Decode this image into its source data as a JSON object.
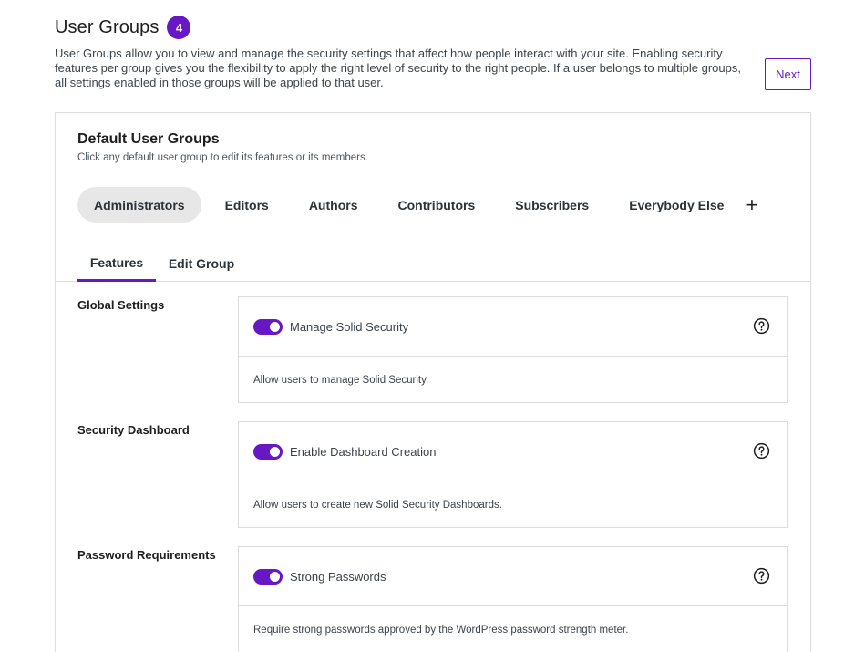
{
  "header": {
    "title": "User Groups",
    "count": "4",
    "description": "User Groups allow you to view and manage the security settings that affect how people interact with your site. Enabling security features per group gives you the flexibility to apply the right level of security to the right people. If a user belongs to multiple groups, all settings enabled in those groups will be applied to that user.",
    "next_label": "Next"
  },
  "card": {
    "title": "Default User Groups",
    "subtitle": "Click any default user group to edit its features or its members.",
    "groups": [
      "Administrators",
      "Editors",
      "Authors",
      "Contributors",
      "Subscribers",
      "Everybody Else"
    ],
    "selected_group": "Administrators",
    "add_symbol": "+",
    "tabs": [
      "Features",
      "Edit Group"
    ],
    "selected_tab": "Features"
  },
  "sections": [
    {
      "label": "Global Settings",
      "feature": "Manage Solid Security",
      "enabled": true,
      "description": "Allow users to manage Solid Security."
    },
    {
      "label": "Security Dashboard",
      "feature": "Enable Dashboard Creation",
      "enabled": true,
      "description": "Allow users to create new Solid Security Dashboards."
    },
    {
      "label": "Password Requirements",
      "feature": "Strong Passwords",
      "enabled": true,
      "description": "Require strong passwords approved by the WordPress password strength meter."
    }
  ],
  "colors": {
    "accent": "#6817c5",
    "border": "#dcdcde",
    "selected_tab_bg": "#e7e7e8"
  },
  "icons": {
    "help": "question-circle-icon",
    "add": "plus-icon"
  }
}
